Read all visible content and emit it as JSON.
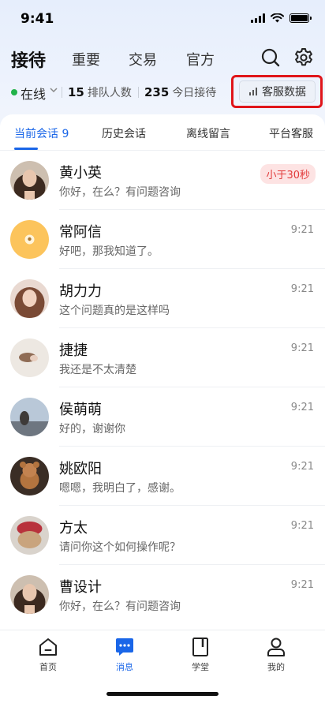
{
  "status_bar": {
    "time": "9:41"
  },
  "header": {
    "tabs": [
      {
        "label": "接待",
        "active": true
      },
      {
        "label": "重要",
        "active": false
      },
      {
        "label": "交易",
        "active": false
      },
      {
        "label": "官方",
        "active": false
      }
    ],
    "icons": [
      "search-icon",
      "gear-icon"
    ]
  },
  "stats": {
    "online_label": "在线",
    "queue_count": "15",
    "queue_label": "排队人数",
    "today_count": "235",
    "today_label": "今日接待",
    "data_button_label": "客服数据"
  },
  "session_tabs": [
    {
      "label": "当前会话 9",
      "active": true
    },
    {
      "label": "历史会话",
      "active": false
    },
    {
      "label": "离线留言",
      "active": false
    },
    {
      "label": "平台客服",
      "active": false
    }
  ],
  "conversations": [
    {
      "name": "黄小英",
      "preview": "你好，在么？有问题咨询",
      "time": "",
      "badge": "小于30秒"
    },
    {
      "name": "常阿信",
      "preview": "好吧，那我知道了。",
      "time": "9:21",
      "badge": ""
    },
    {
      "name": "胡力力",
      "preview": "这个问题真的是这样吗",
      "time": "9:21",
      "badge": ""
    },
    {
      "name": "捷捷",
      "preview": "我还是不太清楚",
      "time": "9:21",
      "badge": ""
    },
    {
      "name": "侯萌萌",
      "preview": "好的，谢谢你",
      "time": "9:21",
      "badge": ""
    },
    {
      "name": "姚欧阳",
      "preview": "嗯嗯，我明白了，感谢。",
      "time": "9:21",
      "badge": ""
    },
    {
      "name": "方太",
      "preview": "请问你这个如何操作呢？",
      "time": "9:21",
      "badge": ""
    },
    {
      "name": "曹设计",
      "preview": "你好，在么？有问题咨询",
      "time": "9:21",
      "badge": ""
    }
  ],
  "bottom_nav": [
    {
      "label": "首页",
      "icon": "home-icon",
      "active": false
    },
    {
      "label": "消息",
      "icon": "message-icon",
      "active": true
    },
    {
      "label": "学堂",
      "icon": "book-icon",
      "active": false
    },
    {
      "label": "我的",
      "icon": "user-icon",
      "active": false
    }
  ],
  "colors": {
    "accent": "#1a66e8",
    "online": "#22b34a",
    "urgent_bg": "#fde3e3",
    "urgent_text": "#e23b3b",
    "highlight_box": "#e0151a"
  }
}
